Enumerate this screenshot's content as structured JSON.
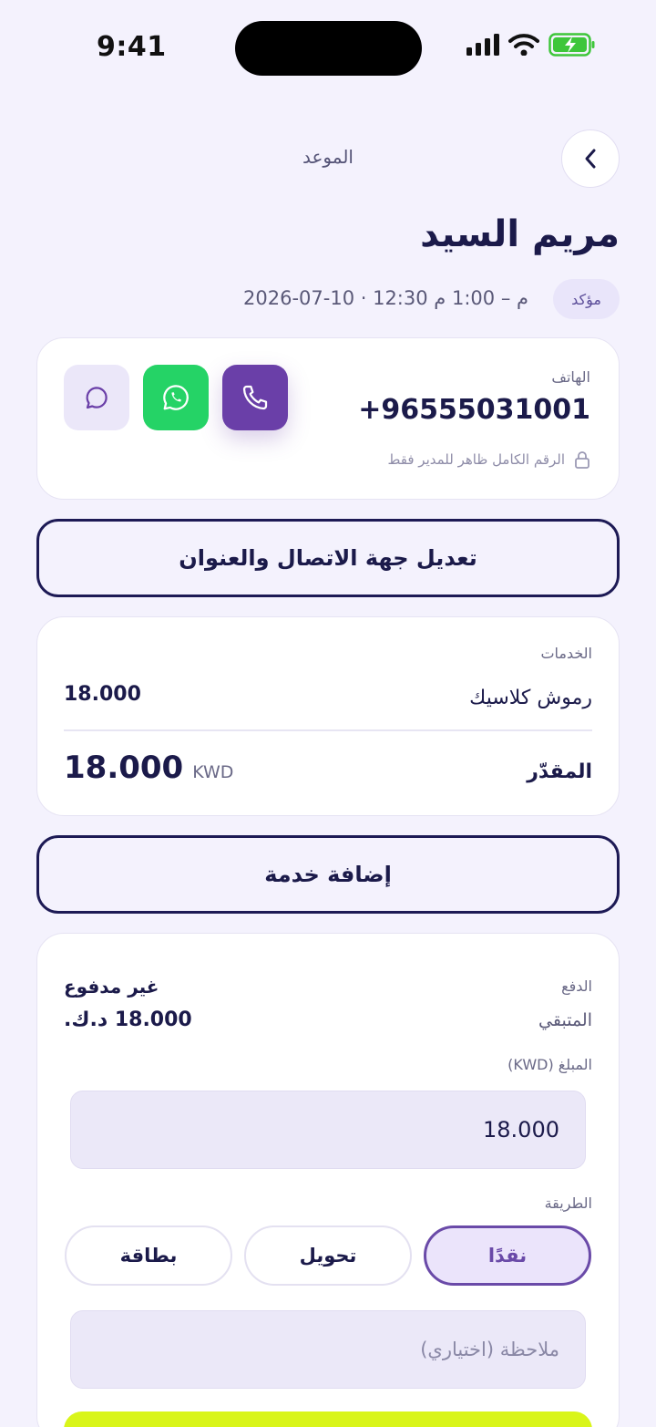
{
  "status_bar": {
    "time": "9:41"
  },
  "header": {
    "title": "الموعد",
    "back_icon": "chevron-left-icon"
  },
  "appointment": {
    "client_name": "مريم السيد",
    "status": "مؤكد",
    "datetime": "2026-07-10 · 12:30 م – 1:00 م"
  },
  "contact": {
    "label": "الهاتف",
    "phone": "+96555031001",
    "note": "الرقم الكامل ظاهر للمدير فقط",
    "call_icon": "phone-icon",
    "whatsapp_icon": "whatsapp-icon",
    "message_icon": "chat-bubble-icon"
  },
  "edit_contact_label": "تعديل جهة الاتصال والعنوان",
  "services": {
    "label": "الخدمات",
    "items": [
      {
        "name": "رموش كلاسيك",
        "price": "18.000"
      }
    ],
    "total_label": "المقدّر",
    "total_currency": "KWD",
    "total_value": "18.000"
  },
  "add_service_label": "إضافة خدمة",
  "payment": {
    "label": "الدفع",
    "status": "غير مدفوع",
    "remaining_label": "المتبقي",
    "remaining_value": "18.000 د.ك.",
    "amount_label": "المبلغ (KWD)",
    "amount_value": "18.000",
    "method_label": "الطريقة",
    "methods": [
      "نقدًا",
      "تحويل",
      "بطاقة"
    ],
    "selected_method": "نقدًا",
    "note_placeholder": "ملاحظة (اختياري)"
  },
  "colors": {
    "background": "#f4f2fd",
    "primary": "#6a3fa8",
    "whatsapp": "#25d366",
    "accent": "#d9f51a",
    "text": "#1b1a4a"
  }
}
